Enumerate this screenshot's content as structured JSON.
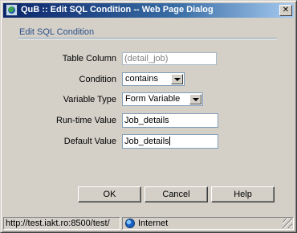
{
  "window": {
    "title": "QuB :: Edit SQL Condition -- Web Page Dialog",
    "close_glyph": "✕"
  },
  "panel": {
    "title": "Edit SQL Condition"
  },
  "form": {
    "table_column": {
      "label": "Table Column",
      "value": "(detail_job)"
    },
    "condition": {
      "label": "Condition",
      "selected": "contains"
    },
    "variable_type": {
      "label": "Variable Type",
      "selected": "Form Variable"
    },
    "runtime_value": {
      "label": "Run-time Value",
      "value": "Job_details"
    },
    "default_value": {
      "label": "Default Value",
      "value": "Job_details"
    }
  },
  "buttons": {
    "ok": "OK",
    "cancel": "Cancel",
    "help": "Help"
  },
  "status": {
    "url": "http://test.iakt.ro:8500/test/",
    "zone": "Internet"
  }
}
